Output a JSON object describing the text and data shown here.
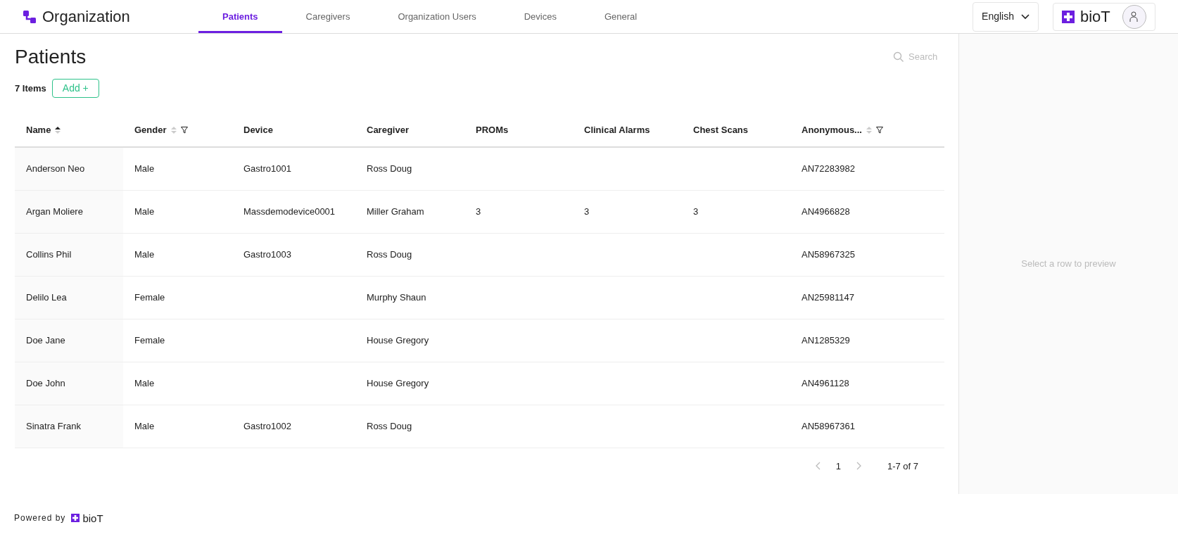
{
  "header": {
    "title": "Organization",
    "tabs": [
      {
        "label": "Patients",
        "selected": true
      },
      {
        "label": "Caregivers",
        "selected": false
      },
      {
        "label": "Organization Users",
        "selected": false
      },
      {
        "label": "Devices",
        "selected": false
      },
      {
        "label": "General",
        "selected": false
      }
    ],
    "language": "English",
    "brand": "bioT"
  },
  "page": {
    "title": "Patients",
    "count": "7 Items",
    "add_button": "Add +",
    "search": {
      "placeholder": "Search"
    }
  },
  "table": {
    "columns": [
      {
        "label": "Name",
        "sortable": true,
        "sorted": true
      },
      {
        "label": "Gender",
        "sortable": true,
        "sorted": false,
        "filter": true
      },
      {
        "label": "Device"
      },
      {
        "label": "Caregiver"
      },
      {
        "label": "PROMs"
      },
      {
        "label": "Clinical Alarms"
      },
      {
        "label": "Chest Scans"
      },
      {
        "label": "Anonymous...",
        "sortable": true,
        "sorted": false,
        "filter": true
      }
    ],
    "rows": [
      [
        "Anderson Neo",
        "Male",
        "Gastro1001",
        "Ross Doug",
        "",
        "",
        "",
        "AN72283982"
      ],
      [
        "Argan Moliere",
        "Male",
        "Massdemodevice0001",
        "Miller Graham",
        "3",
        "3",
        "3",
        "AN4966828"
      ],
      [
        "Collins Phil",
        "Male",
        "Gastro1003",
        "Ross Doug",
        "",
        "",
        "",
        "AN58967325"
      ],
      [
        "Delilo Lea",
        "Female",
        "",
        "Murphy Shaun",
        "",
        "",
        "",
        "AN25981147"
      ],
      [
        "Doe Jane",
        "Female",
        "",
        "House Gregory",
        "",
        "",
        "",
        "AN1285329"
      ],
      [
        "Doe John",
        "Male",
        "",
        "House Gregory",
        "",
        "",
        "",
        "AN4961128"
      ],
      [
        "Sinatra Frank",
        "Male",
        "Gastro1002",
        "Ross Doug",
        "",
        "",
        "",
        "AN58967361"
      ]
    ]
  },
  "pagination": {
    "page": "1",
    "range": "1-7 of 7"
  },
  "preview": {
    "message": "Select a row to preview"
  },
  "footer": {
    "powered_by": "Powered by",
    "brand": "bioT"
  }
}
